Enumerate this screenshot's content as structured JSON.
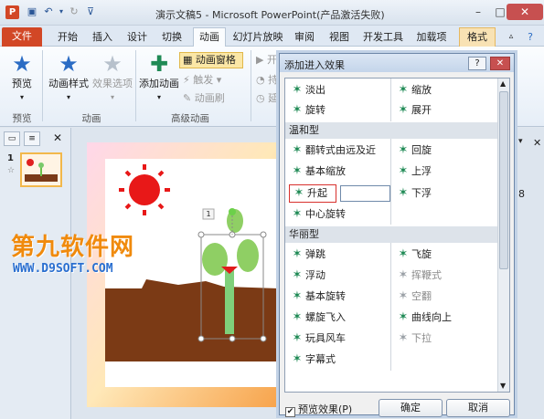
{
  "window": {
    "title": "演示文稿5 - Microsoft PowerPoint(产品激活失败)",
    "app_icon": "P",
    "controls": [
      "–",
      "□",
      "✕"
    ]
  },
  "tabs": {
    "file": "文件",
    "items": [
      "开始",
      "插入",
      "设计",
      "切换",
      "动画",
      "幻灯片放映",
      "审阅",
      "视图",
      "开发工具",
      "加载项",
      "格式"
    ],
    "active": "动画"
  },
  "ribbon": {
    "preview": "预览",
    "anim_style": "动画样式",
    "effect_options": "效果选项",
    "add_anim": "添加动画",
    "anim_pane": "动画窗格",
    "trigger": "触发",
    "anim_brush": "动画刷",
    "start_label": "开",
    "duration_label": "持",
    "delay_label": "延",
    "groups": {
      "preview": "预览",
      "animation": "动画",
      "advanced": "高级动画"
    }
  },
  "slides_pane": {
    "slide_number": "1",
    "star_mark": "☆"
  },
  "slide": {
    "anim_tag": "1"
  },
  "right_strip": {
    "text": "8"
  },
  "dialog": {
    "title": "添加进入效果",
    "help": "?",
    "close": "✕",
    "rows": {
      "row0": {
        "left": "淡出",
        "right": "缩放"
      },
      "row1": {
        "left": "旋转",
        "right": "展开"
      }
    },
    "category_moderate": "温和型",
    "moderate": {
      "l0": "翻转式由远及近",
      "r0": "回旋",
      "l1": "基本缩放",
      "r1": "上浮",
      "l2": "升起",
      "r2": "下浮",
      "l3": "中心旋转"
    },
    "category_exciting": "华丽型",
    "exciting": {
      "l0": "弹跳",
      "r0": "飞旋",
      "l1": "浮动",
      "r1": "挥鞭式",
      "l2": "基本旋转",
      "r2": "空翻",
      "l3": "螺旋飞入",
      "r3": "曲线向上",
      "l4": "玩具风车",
      "r4": "下拉",
      "l5": "字幕式"
    },
    "preview_checkbox": "预览效果(P)",
    "preview_checked": "✔",
    "ok": "确定",
    "cancel": "取消"
  },
  "watermark": {
    "line1": "第九软件网",
    "line2": "WWW.D9SOFT.COM"
  }
}
